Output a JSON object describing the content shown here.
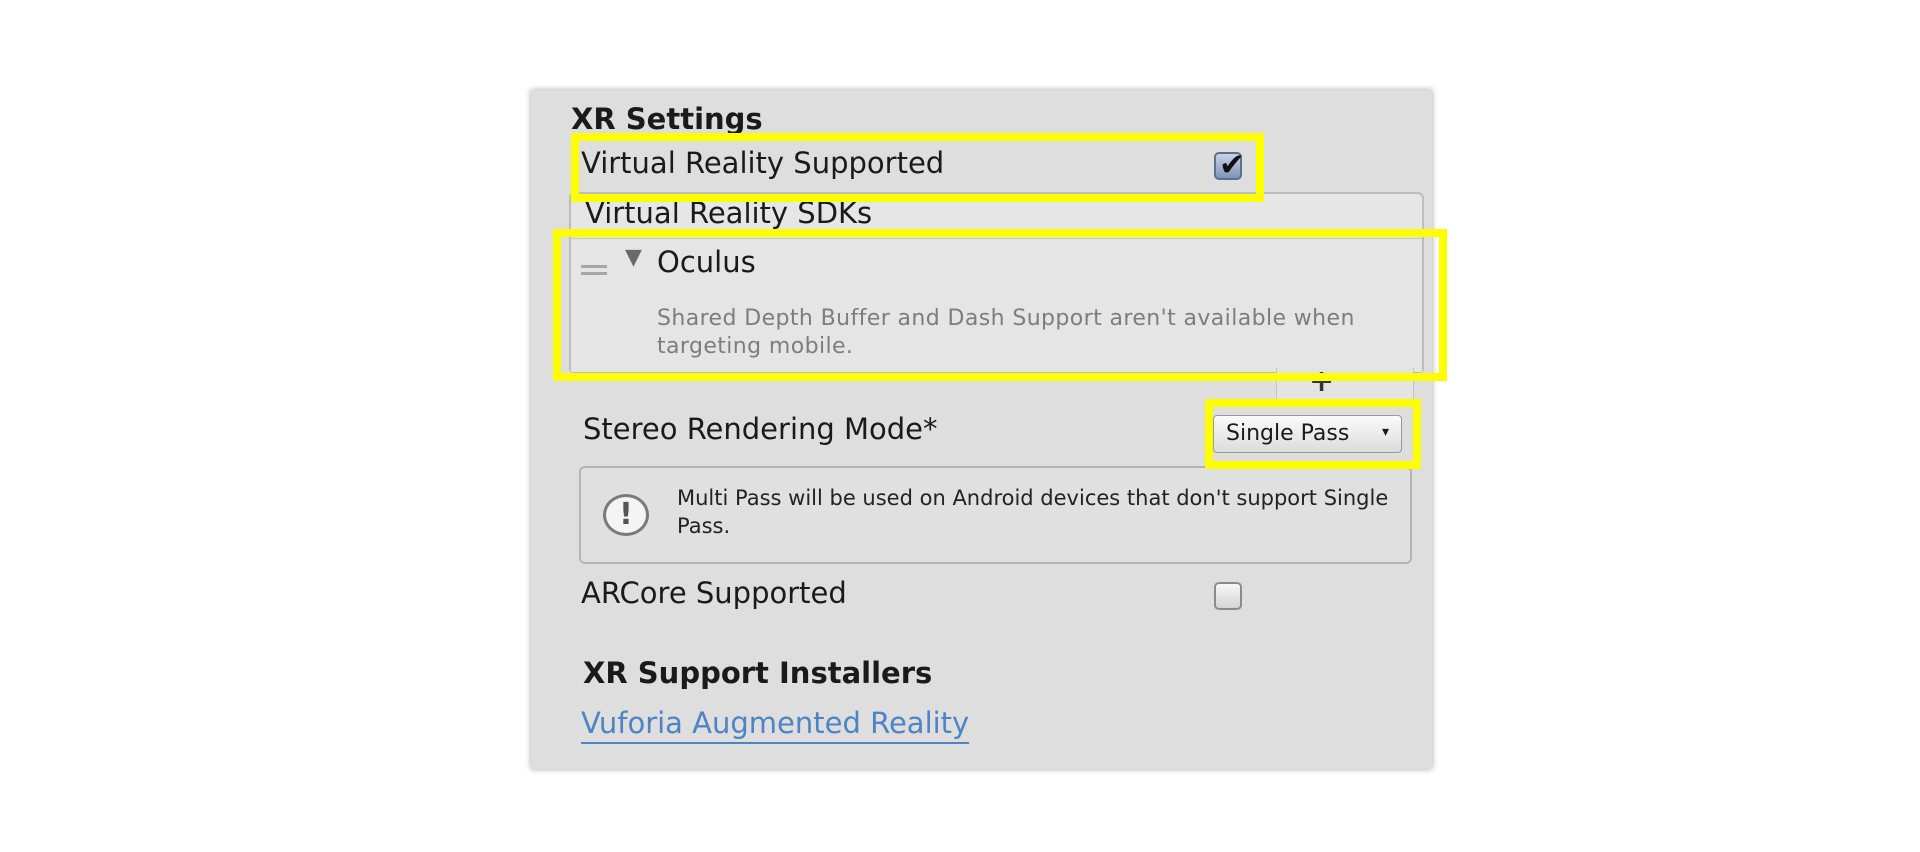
{
  "xr_settings": {
    "title": "XR Settings",
    "vr_supported": {
      "label": "Virtual Reality Supported",
      "checked": true
    },
    "sdks": {
      "header": "Virtual Reality SDKs",
      "items": [
        {
          "name": "Oculus",
          "expanded": true,
          "note": "Shared Depth Buffer and Dash Support aren't available when targeting mobile."
        }
      ],
      "add_button": "+",
      "remove_button": "−"
    },
    "stereo_rendering": {
      "label": "Stereo Rendering Mode*",
      "value": "Single Pass"
    },
    "help_message": "Multi Pass will be used on Android devices that don't support Single Pass.",
    "arcore_supported": {
      "label": "ARCore Supported",
      "checked": false
    }
  },
  "installers": {
    "title": "XR Support Installers",
    "link": "Vuforia Augmented Reality"
  },
  "icons": {
    "checkbox_tick": "✔",
    "foldout": "▼",
    "dropdown_arrow": "▾",
    "help": "!"
  },
  "colors": {
    "highlight": "#ffff00",
    "link": "#4d84c5",
    "panel_bg": "#dedede"
  }
}
